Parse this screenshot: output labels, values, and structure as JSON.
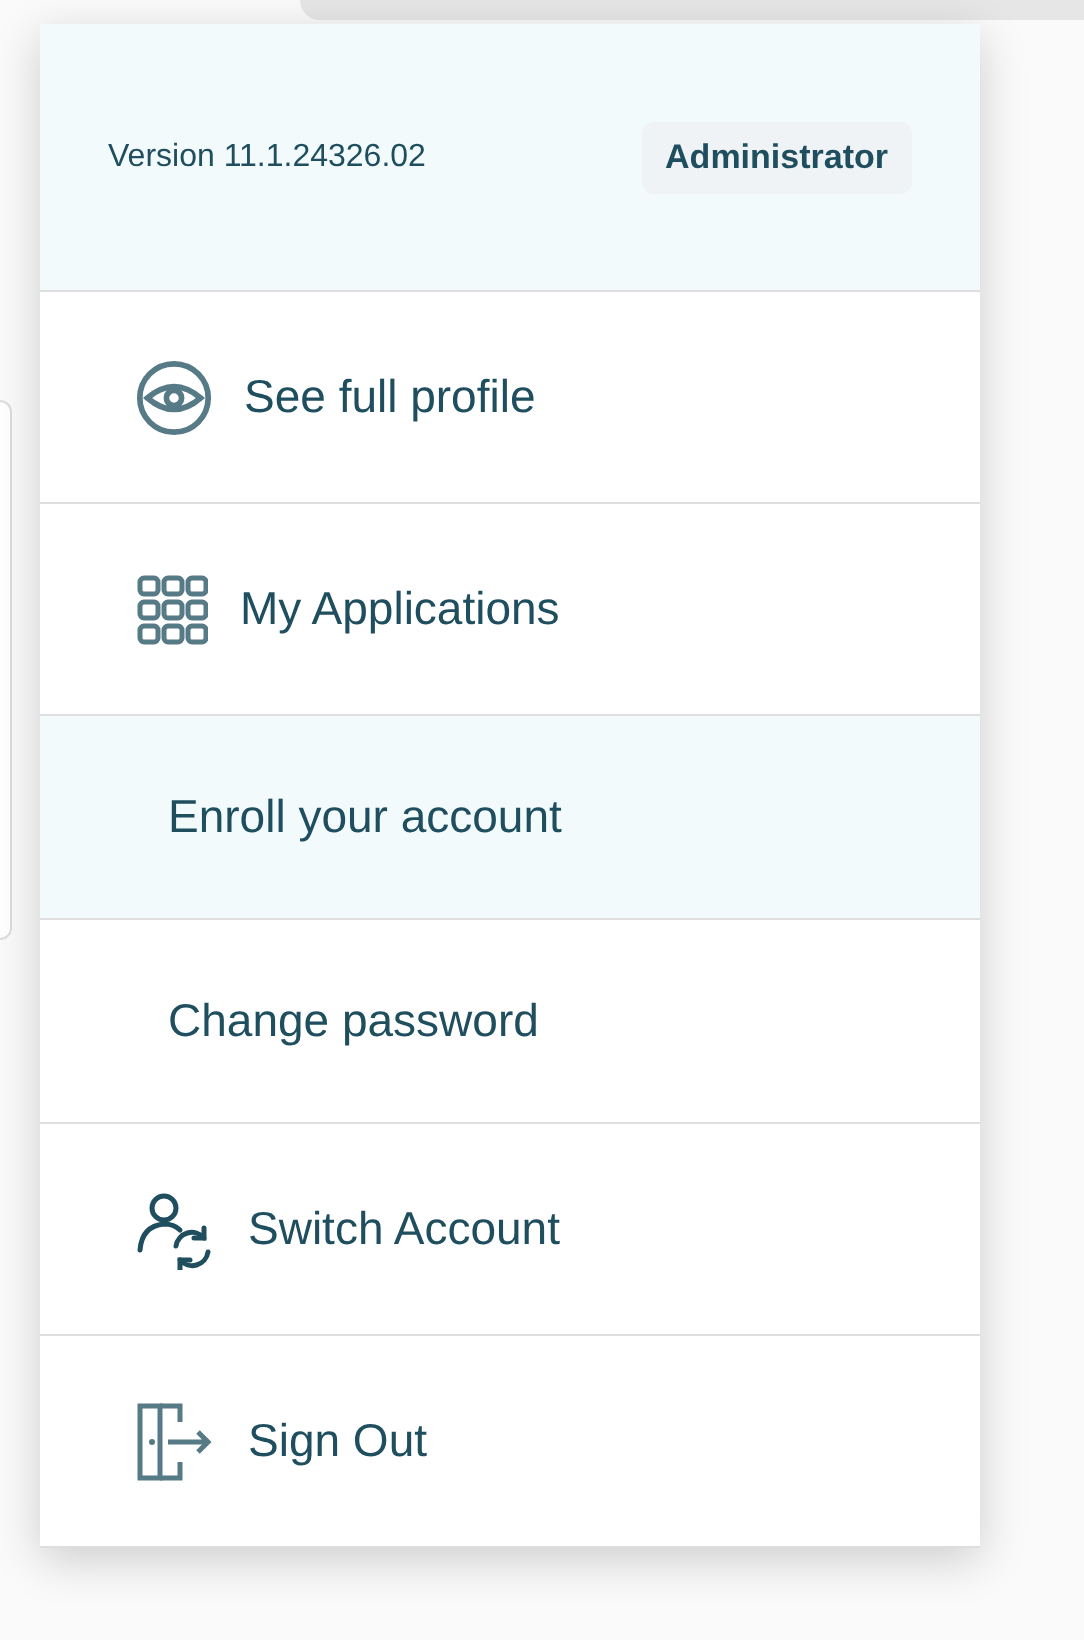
{
  "header": {
    "version": "Version 11.1.24326.02",
    "role": "Administrator"
  },
  "items": [
    {
      "label": "See full profile",
      "kind": "eye",
      "selected": false
    },
    {
      "label": "My Applications",
      "kind": "grid",
      "selected": false
    },
    {
      "label": "Enroll your account",
      "kind": "plain",
      "selected": true
    },
    {
      "label": "Change password",
      "kind": "plain",
      "selected": false
    },
    {
      "label": "Switch Account",
      "kind": "switch",
      "selected": false
    },
    {
      "label": "Sign Out",
      "kind": "door",
      "selected": false
    }
  ]
}
